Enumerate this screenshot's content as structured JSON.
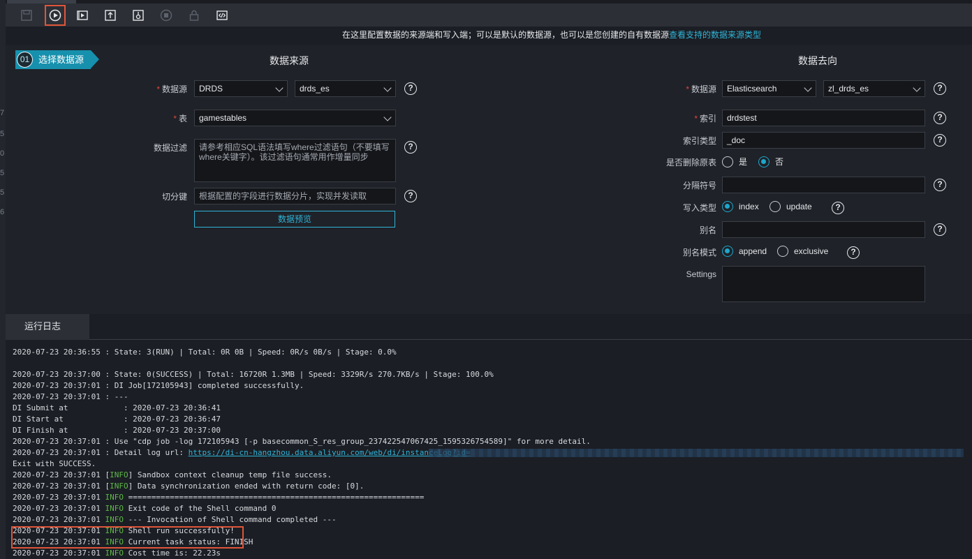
{
  "banner": {
    "text": "在这里配置数据的来源端和写入端；可以是默认的数据源，也可以是您创建的自有数据源",
    "link": "查看支持的数据来源类型"
  },
  "step": {
    "number": "01",
    "label": "选择数据源"
  },
  "source": {
    "title": "数据来源",
    "datasource_label": "数据源",
    "datasource_type": "DRDS",
    "datasource_name": "drds_es",
    "table_label": "表",
    "table_value": "gamestables",
    "filter_label": "数据过滤",
    "filter_placeholder": "请参考相应SQL语法填写where过滤语句（不要填写where关键字）。该过滤语句通常用作增量同步",
    "split_label": "切分键",
    "split_placeholder": "根据配置的字段进行数据分片，实现并发读取",
    "preview_button": "数据预览"
  },
  "target": {
    "title": "数据去向",
    "datasource_label": "数据源",
    "datasource_type": "Elasticsearch",
    "datasource_name": "zl_drds_es",
    "index_label": "索引",
    "index_value": "drdstest",
    "index_type_label": "索引类型",
    "index_type_value": "_doc",
    "delete_label": "是否删除原表",
    "delete_yes": "是",
    "delete_no": "否",
    "delete_selected": "否",
    "separator_label": "分隔符号",
    "write_type_label": "写入类型",
    "write_index": "index",
    "write_update": "update",
    "write_selected": "index",
    "alias_label": "别名",
    "alias_mode_label": "别名模式",
    "alias_append": "append",
    "alias_exclusive": "exclusive",
    "alias_selected": "append",
    "settings_label": "Settings"
  },
  "help_glyph": "?",
  "log_tab": "运行日志",
  "log": {
    "l1": "2020-07-23 20:36:55 : State: 3(RUN) | Total: 0R 0B | Speed: 0R/s 0B/s | Stage: 0.0%",
    "l2": "2020-07-23 20:37:00 : State: 0(SUCCESS) | Total: 16720R 1.3MB | Speed: 3329R/s 270.7KB/s | Stage: 100.0%",
    "l3": "2020-07-23 20:37:01 : DI Job[172105943] completed successfully.",
    "l4": "2020-07-23 20:37:01 : ---",
    "l5": "DI Submit at            : 2020-07-23 20:36:41",
    "l6": "DI Start at             : 2020-07-23 20:36:47",
    "l7": "DI Finish at            : 2020-07-23 20:37:00",
    "l8": "2020-07-23 20:37:01 : Use \"cdp job -log 172105943 [-p basecommon_S_res_group_237422547067425_1595326754589]\" for more detail.",
    "l9_prefix": "2020-07-23 20:37:01 : Detail log url: ",
    "l9_link": "https://di-cn-hangzhou.data.aliyun.com/web/di/instanceLog?id=",
    "l10": "Exit with SUCCESS.",
    "l11_prefix": "2020-07-23 20:37:01 [",
    "l11_info": "INFO",
    "l11_suffix": "] Sandbox context cleanup temp file success.",
    "l12_prefix": "2020-07-23 20:37:01 [",
    "l12_info": "INFO",
    "l12_suffix": "] Data synchronization ended with return code: [0].",
    "ts": "2020-07-23 20:37:01 ",
    "info": "INFO",
    "l13": " ================================================================",
    "l14": " Exit code of the Shell command 0",
    "l15": " --- Invocation of Shell command completed ---",
    "l16": " Shell run successfully!",
    "l17": " Current task status: FINISH",
    "l18": " Cost time is: 22.23s"
  },
  "gutter_marks": [
    "7",
    "5",
    "0",
    "5",
    "5",
    "6"
  ],
  "colors": {
    "accent": "#1ea7cc",
    "highlight": "#e0553a",
    "info": "#5fb84a",
    "required": "#e2453c"
  }
}
